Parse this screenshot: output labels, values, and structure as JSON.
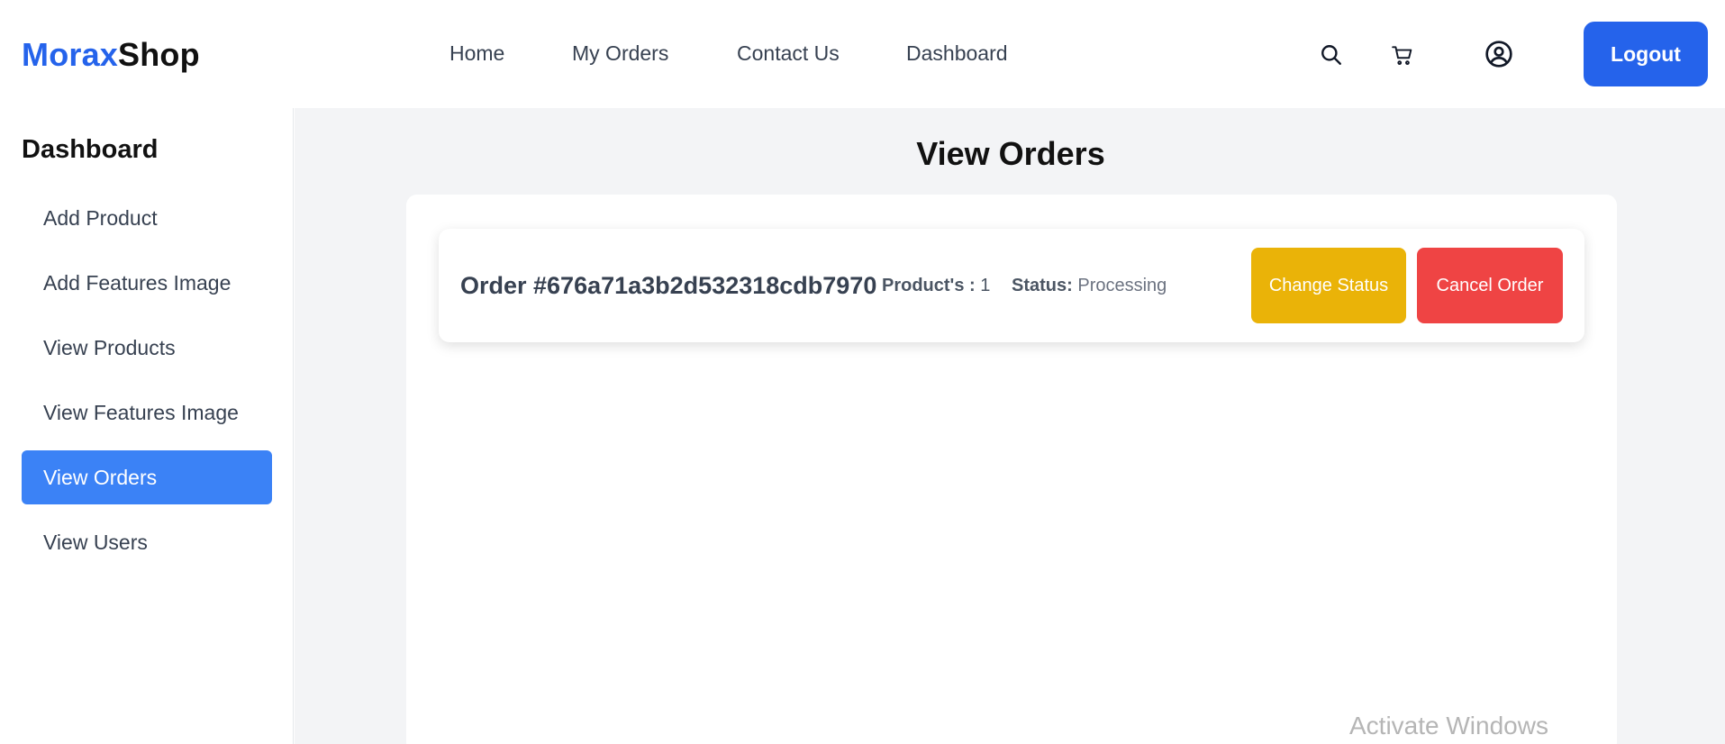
{
  "brand": {
    "part1": "Morax",
    "part2": "Shop",
    "color_primary": "#2563eb"
  },
  "nav": {
    "links": [
      "Home",
      "My Orders",
      "Contact Us",
      "Dashboard"
    ],
    "icons": [
      "search-icon",
      "cart-icon",
      "user-circle-icon"
    ],
    "logout_label": "Logout"
  },
  "sidebar": {
    "title": "Dashboard",
    "items": [
      {
        "label": "Add Product",
        "active": false
      },
      {
        "label": "Add Features Image",
        "active": false
      },
      {
        "label": "View Products",
        "active": false
      },
      {
        "label": "View Features Image",
        "active": false
      },
      {
        "label": "View Orders",
        "active": true
      },
      {
        "label": "View Users",
        "active": false
      }
    ],
    "active_color": "#3b82f6"
  },
  "main": {
    "title": "View Orders",
    "orders": [
      {
        "id_text": "Order #676a71a3b2d532318cdb7970",
        "products_label": "Product's :",
        "products_count": "1",
        "status_label": "Status:",
        "status_value": "Processing",
        "change_status_label": "Change Status",
        "cancel_label": "Cancel Order"
      }
    ],
    "colors": {
      "change_status": "#eab308",
      "cancel": "#ef4444"
    }
  },
  "watermark": "Activate Windows"
}
